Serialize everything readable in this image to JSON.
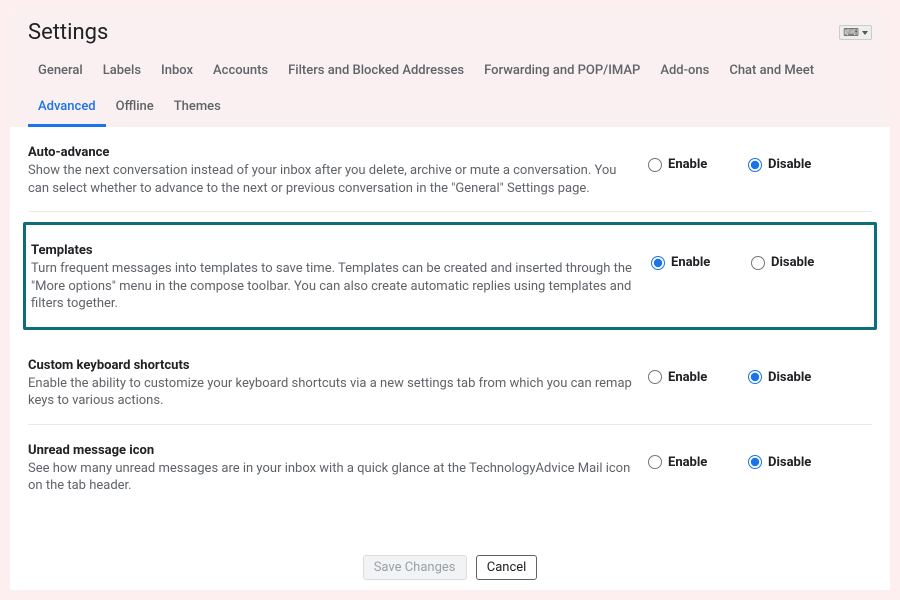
{
  "header": {
    "title": "Settings",
    "input_indicator": "⌨"
  },
  "tabs": [
    {
      "label": "General",
      "active": false
    },
    {
      "label": "Labels",
      "active": false
    },
    {
      "label": "Inbox",
      "active": false
    },
    {
      "label": "Accounts",
      "active": false
    },
    {
      "label": "Filters and Blocked Addresses",
      "active": false
    },
    {
      "label": "Forwarding and POP/IMAP",
      "active": false
    },
    {
      "label": "Add-ons",
      "active": false
    },
    {
      "label": "Chat and Meet",
      "active": false
    },
    {
      "label": "Advanced",
      "active": true
    },
    {
      "label": "Offline",
      "active": false
    },
    {
      "label": "Themes",
      "active": false
    }
  ],
  "settings": [
    {
      "key": "auto-advance",
      "title": "Auto-advance",
      "description": "Show the next conversation instead of your inbox after you delete, archive or mute a conversation. You can select whether to advance to the next or previous conversation in the \"General\" Settings page.",
      "selected": "disable",
      "highlighted": false
    },
    {
      "key": "templates",
      "title": "Templates",
      "description": "Turn frequent messages into templates to save time. Templates can be created and inserted through the \"More options\" menu in the compose toolbar. You can also create automatic replies using templates and filters together.",
      "selected": "enable",
      "highlighted": true
    },
    {
      "key": "custom-keyboard-shortcuts",
      "title": "Custom keyboard shortcuts",
      "description": "Enable the ability to customize your keyboard shortcuts via a new settings tab from which you can remap keys to various actions.",
      "selected": "disable",
      "highlighted": false
    },
    {
      "key": "unread-message-icon",
      "title": "Unread message icon",
      "description": "See how many unread messages are in your inbox with a quick glance at the TechnologyAdvice Mail icon on the tab header.",
      "selected": "disable",
      "highlighted": false
    }
  ],
  "radio_labels": {
    "enable": "Enable",
    "disable": "Disable"
  },
  "footer": {
    "save": "Save Changes",
    "cancel": "Cancel"
  }
}
